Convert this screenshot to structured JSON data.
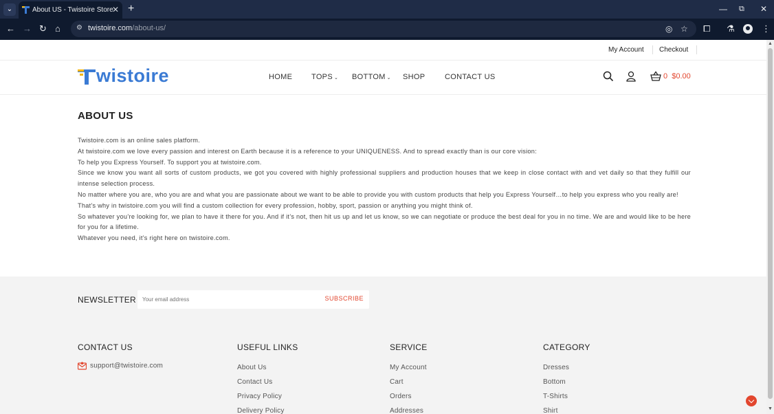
{
  "browser": {
    "tab_title": "About US - Twistoire Store",
    "url_host": "twistoire.com",
    "url_path": "/about-us/"
  },
  "topbar": {
    "my_account": "My Account",
    "checkout": "Checkout"
  },
  "header": {
    "logo_text": "wistoire",
    "nav": [
      "HOME",
      "TOPS",
      "BOTTOM",
      "SHOP",
      "CONTACT US"
    ],
    "cart_count": "0",
    "cart_total": "$0.00"
  },
  "content": {
    "title": "ABOUT US",
    "paragraphs": [
      "Twistoire.com is an online sales platform.",
      "At twistoire.com we love every passion and interest on Earth because it is a reference to your UNIQUENESS. And to spread exactly than is our core vision:",
      "To help you Express Yourself. To support you at twistoire.com.",
      "Since we know you want all sorts of custom products, we got you covered with highly professional suppliers and production houses that we keep in close contact with and vet daily so that they fulfill our intense selection process.",
      "No matter where you are, who you are and what you are passionate about we want to be able to provide you with custom products that help you Express Yourself…to help you express who you really are!",
      "That’s why in twistoire.com you will find a custom collection for every profession, hobby, sport, passion or anything you might think of.",
      "So whatever you’re looking for, we plan to have it there for you. And if it’s not, then hit us up and let us know, so we can negotiate or produce the best deal for you in no time. We are and would like to be here for you  for a lifetime.",
      "Whatever you need, it’s right here on twistoire.com."
    ]
  },
  "newsletter": {
    "label": "NEWSLETTER",
    "placeholder": "Your email address",
    "button": "SUBSCRIBE"
  },
  "footer": {
    "contact": {
      "title": "CONTACT US",
      "email": "support@twistoire.com"
    },
    "useful_links": {
      "title": "USEFUL LINKS",
      "items": [
        "About Us",
        "Contact Us",
        "Privacy Policy",
        "Delivery Policy"
      ]
    },
    "service": {
      "title": "SERVICE",
      "items": [
        "My Account",
        "Cart",
        "Orders",
        "Addresses"
      ]
    },
    "category": {
      "title": "CATEGORY",
      "items": [
        "Dresses",
        "Bottom",
        "T-Shirts",
        "Shirt"
      ]
    }
  },
  "colors": {
    "accent": "#e2462e",
    "logo_blue": "#3b7bd4",
    "logo_yellow": "#f5b400",
    "chrome_dark": "#0f1a2e"
  }
}
